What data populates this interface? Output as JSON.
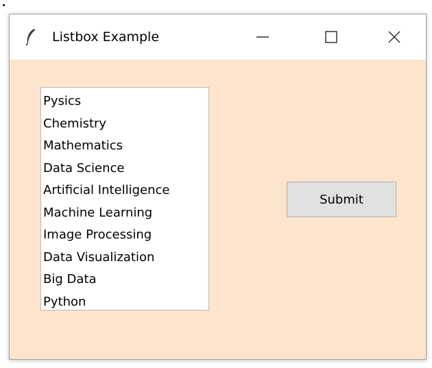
{
  "window": {
    "title": "Listbox Example",
    "controls": {
      "minimize": "minimize-icon",
      "maximize": "maximize-icon",
      "close": "close-icon"
    },
    "background_color": "#fce4cd"
  },
  "listbox": {
    "items": [
      "Pysics",
      "Chemistry",
      "Mathematics",
      "Data Science",
      "Artificial Intelligence",
      "Machine Learning",
      "Image Processing",
      "Data Visualization",
      "Big Data",
      "Python"
    ]
  },
  "submit_button": {
    "label": "Submit"
  }
}
